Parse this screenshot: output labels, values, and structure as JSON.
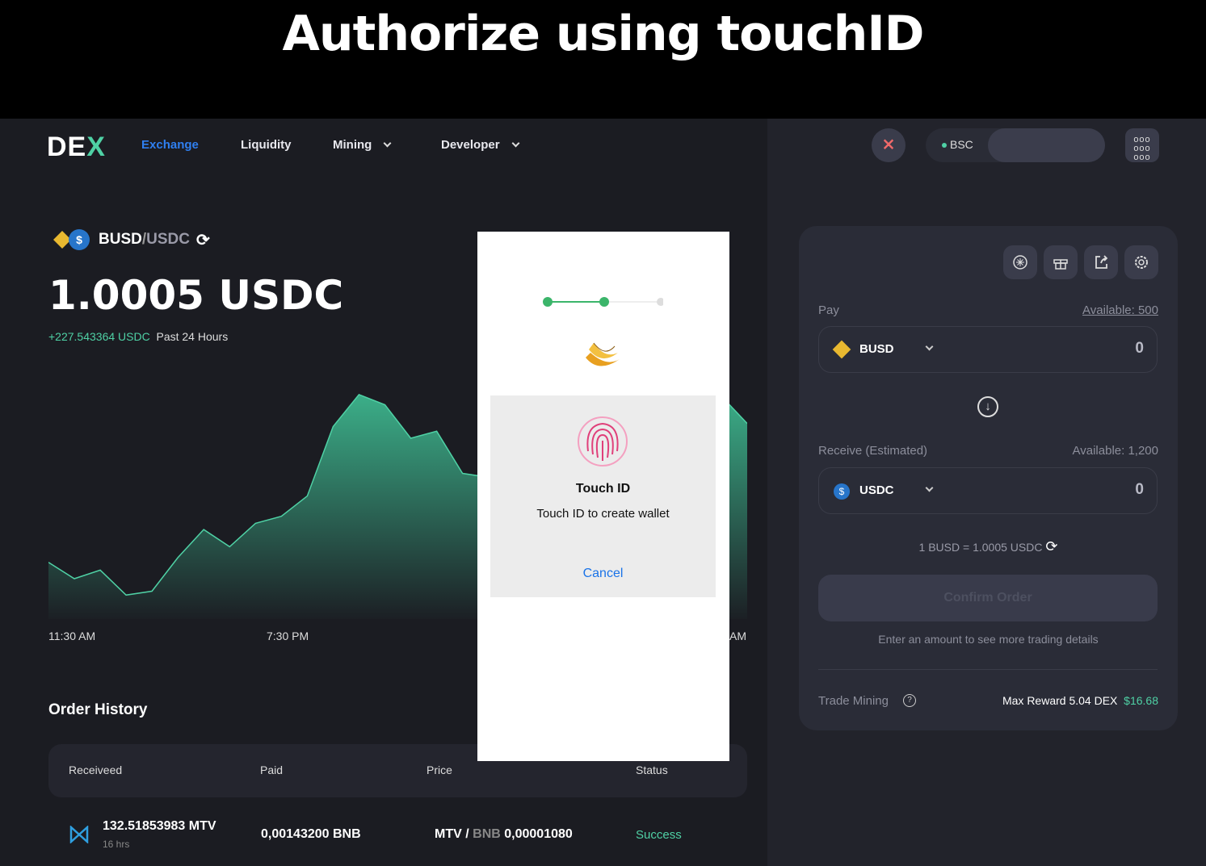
{
  "banner": {
    "title": "Authorize using touchID"
  },
  "nav": {
    "logo": "DEX",
    "items": [
      {
        "label": "Exchange",
        "active": true
      },
      {
        "label": "Liquidity"
      },
      {
        "label": "Mining",
        "dropdown": true
      },
      {
        "label": "Developer",
        "dropdown": true
      }
    ]
  },
  "network": {
    "label": "BSC",
    "dot_color": "#4fd1a5"
  },
  "pair": {
    "base": "BUSD",
    "slash": "/",
    "quote": "USDC",
    "price": "1.0005 USDC",
    "change": "+227.543364 USDC",
    "period": "Past 24 Hours"
  },
  "price_chart": {
    "time_labels": [
      "11:30 AM",
      "7:30 PM",
      ""
    ],
    "time_label_fragment": "AM",
    "values": [
      52,
      31,
      42,
      10,
      15,
      58,
      94,
      72,
      102,
      111,
      137,
      226,
      267,
      254,
      211,
      220,
      166,
      161,
      214,
      76,
      85,
      50,
      31,
      48,
      67,
      75,
      265,
      230
    ],
    "color": "#3fbf94"
  },
  "order_history": {
    "title": "Order History",
    "columns": [
      "Receiveed",
      "Paid",
      "Price",
      "Status"
    ],
    "rows": [
      {
        "received": "132.51853983 MTV",
        "time": "16 hrs",
        "paid": "0,00143200 BNB",
        "price_base": "MTV",
        "price_sep": "/",
        "price_quote": "BNB",
        "price_value": "0,00001080",
        "status": "Success"
      }
    ]
  },
  "modal": {
    "steps": 3,
    "completed_steps": 2,
    "title": "Touch ID",
    "message": "Touch ID to create wallet",
    "cancel": "Cancel"
  },
  "swap": {
    "pay_label": "Pay",
    "pay_available": "Available: 500",
    "pay_token": "BUSD",
    "pay_amount": "0",
    "receive_label": "Receive (Estimated)",
    "receive_available": "Available: 1,200",
    "receive_token": "USDC",
    "receive_amount": "0",
    "rate": "1 BUSD = 1.0005 USDC",
    "confirm": "Confirm Order",
    "hint": "Enter an amount to see more trading details",
    "trade_mining": "Trade Mining",
    "max_reward": "Max Reward 5.04 DEX",
    "reward_usd": "$16.68"
  },
  "colors": {
    "accent_blue": "#2f7ff0",
    "green": "#4fd1a5",
    "red": "#f06a6a"
  }
}
